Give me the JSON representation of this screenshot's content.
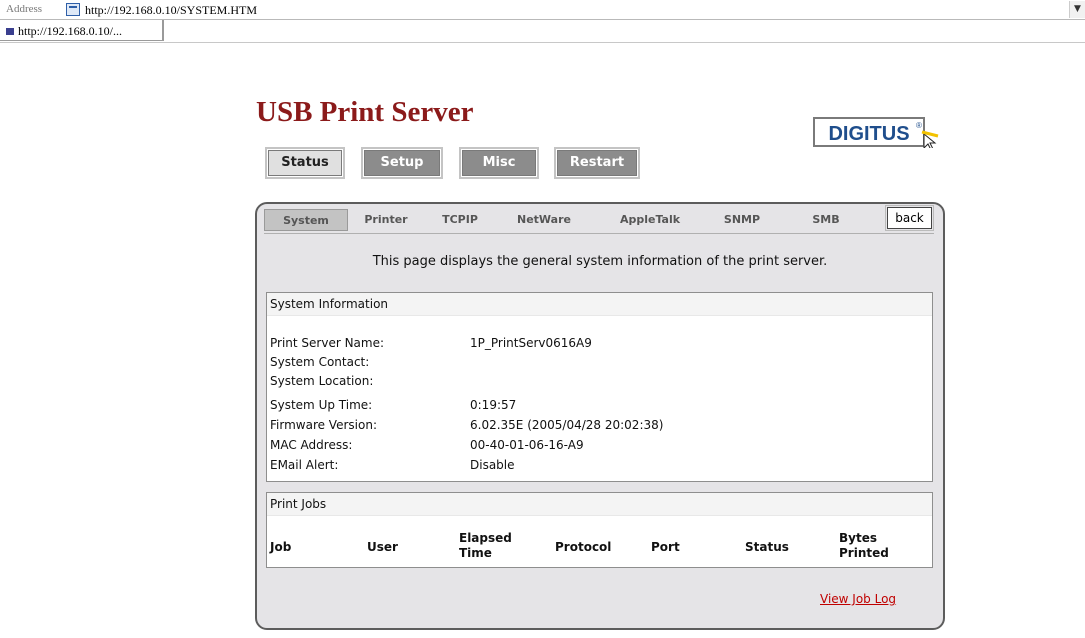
{
  "browser": {
    "address_label": "Address",
    "url": "http://192.168.0.10/SYSTEM.HTM",
    "tab_label": "http://192.168.0.10/..."
  },
  "header": {
    "title": "USB Print Server",
    "logo_text": "DIGITUS",
    "logo_mark": "®"
  },
  "nav": {
    "status": "Status",
    "setup": "Setup",
    "misc": "Misc",
    "restart": "Restart"
  },
  "subtabs": {
    "system": "System",
    "printer": "Printer",
    "tcpip": "TCPIP",
    "netware": "NetWare",
    "appletalk": "AppleTalk",
    "snmp": "SNMP",
    "smb": "SMB",
    "back": "back"
  },
  "description": "This page displays the general system information of the print server.",
  "system_info": {
    "heading": "System Information",
    "rows": [
      {
        "label": "Print Server Name:",
        "value": "1P_PrintServ0616A9"
      },
      {
        "label": "System Contact:",
        "value": ""
      },
      {
        "label": "System Location:",
        "value": ""
      },
      {
        "label": "System Up Time:",
        "value": "0:19:57"
      },
      {
        "label": "Firmware Version:",
        "value": "6.02.35E (2005/04/28 20:02:38)"
      },
      {
        "label": "MAC Address:",
        "value": "00-40-01-06-16-A9"
      },
      {
        "label": "EMail Alert:",
        "value": "Disable"
      }
    ]
  },
  "print_jobs": {
    "heading": "Print Jobs",
    "columns": {
      "job": "Job",
      "user": "User",
      "elapsed_1": "Elapsed",
      "elapsed_2": "Time",
      "protocol": "Protocol",
      "port": "Port",
      "status": "Status",
      "bytes_1": "Bytes",
      "bytes_2": "Printed"
    },
    "view_log": "View Job Log"
  },
  "colors": {
    "title": "#8b1a1a",
    "logo": "#1f4e8c",
    "link": "#c00000",
    "panel": "#e5e4e7"
  }
}
